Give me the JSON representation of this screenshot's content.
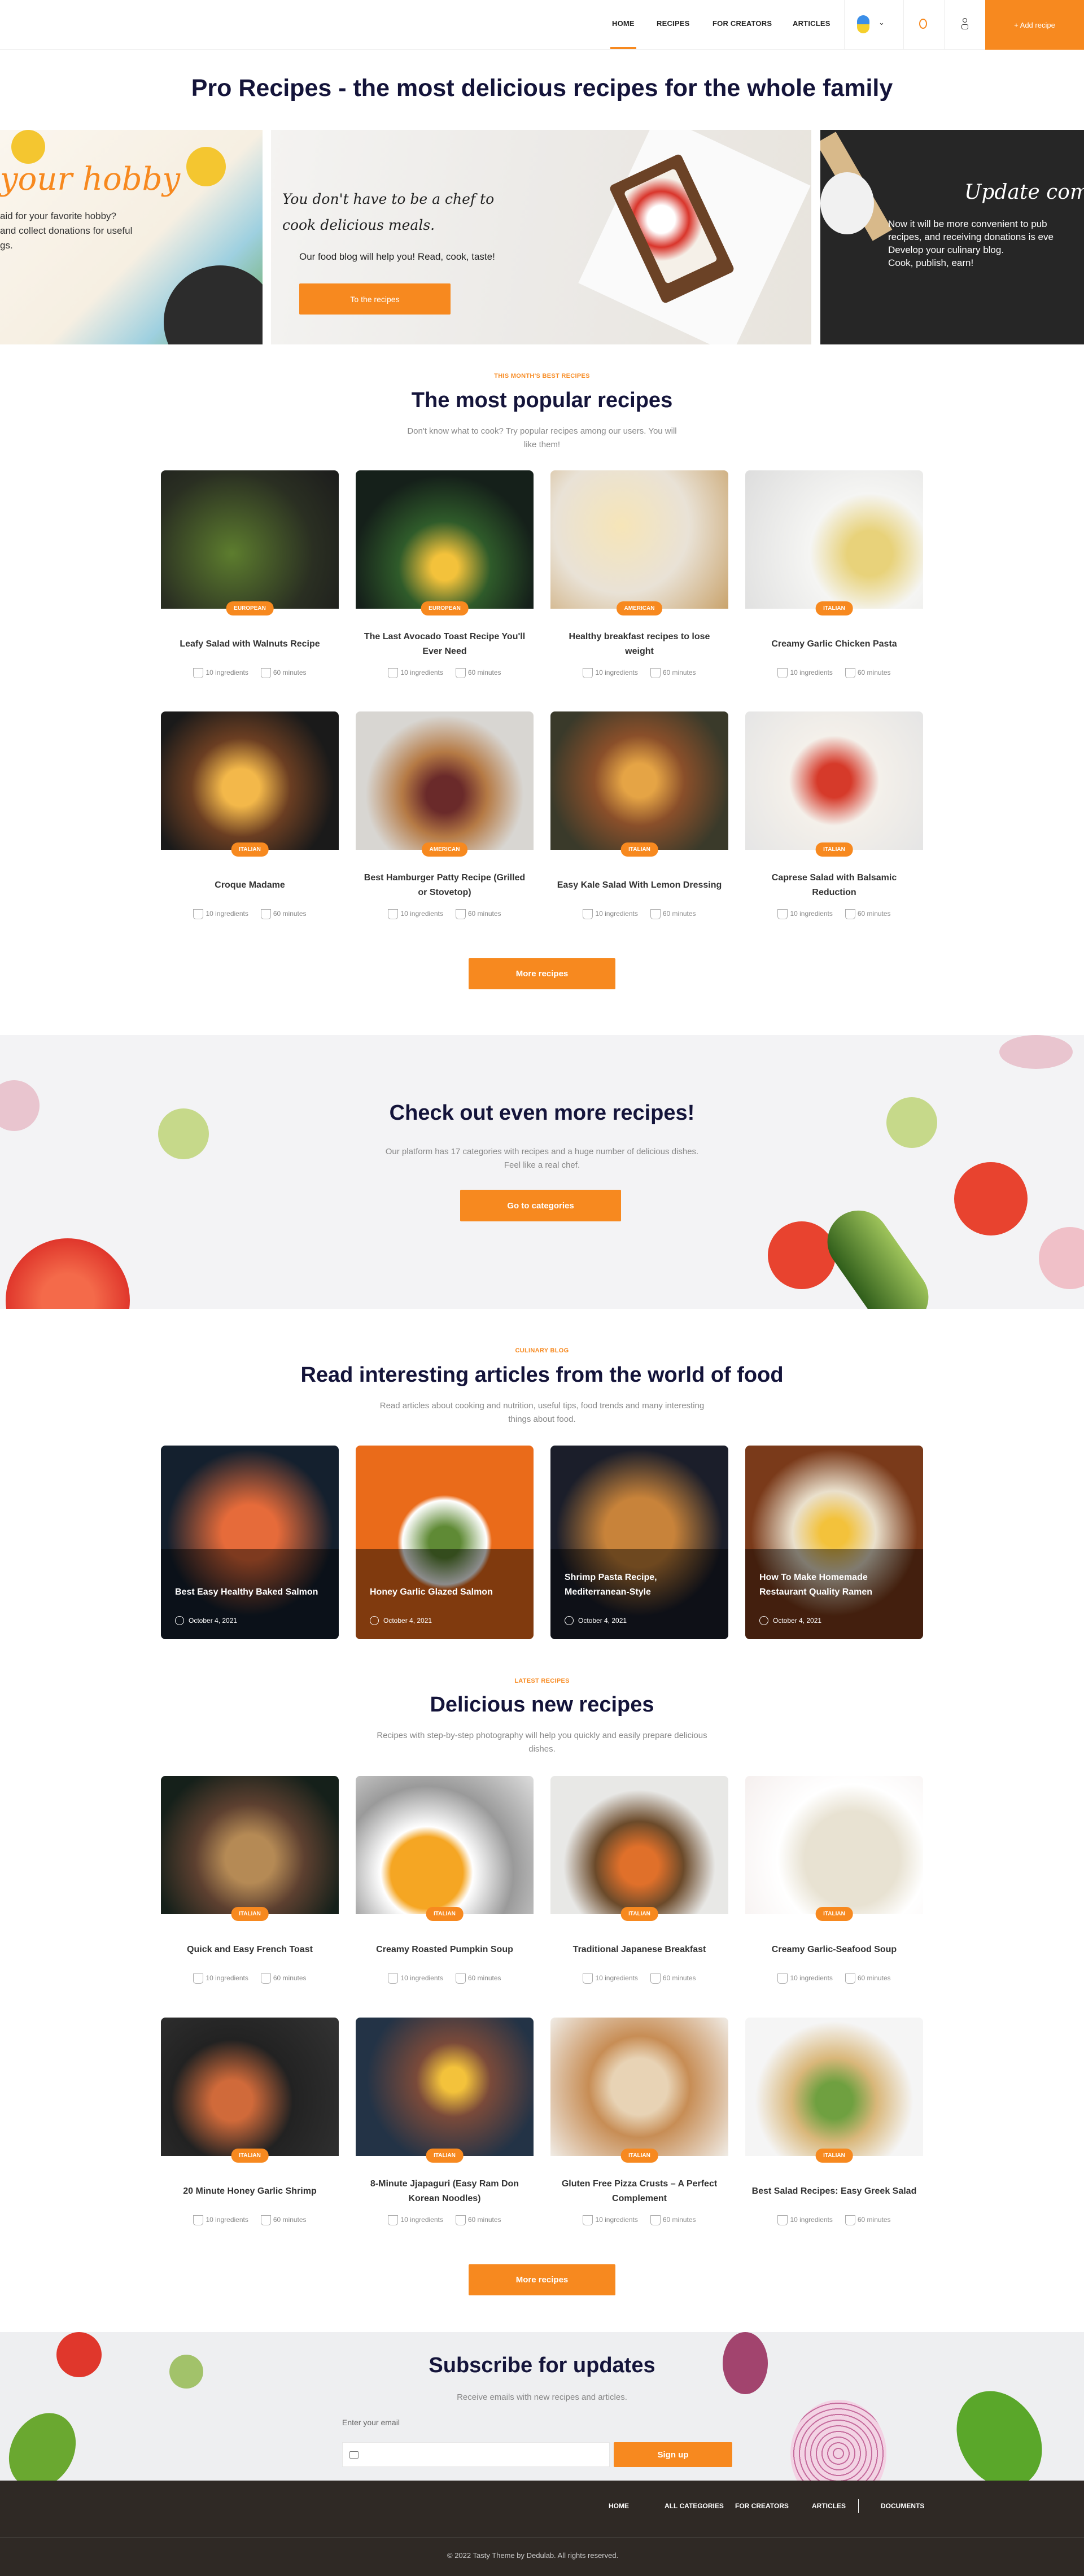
{
  "colors": {
    "accent": "#f7891f",
    "heading": "#14143a",
    "footer_bg": "#2f2925"
  },
  "header": {
    "nav": [
      "HOME",
      "RECIPES",
      "FOR CREATORS",
      "ARTICLES"
    ],
    "active": "HOME",
    "language_icon": "ukraine-flag-icon",
    "add_recipe": "+ Add recipe"
  },
  "page_title": "Pro Recipes - the most delicious recipes for the whole family",
  "hero": {
    "left": {
      "title": "your hobby",
      "text": [
        "aid for your favorite hobby?",
        "and collect donations for useful",
        "gs."
      ]
    },
    "center": {
      "title": "You don't have to be a chef to cook delicious meals.",
      "text": "Our food blog will help you! Read, cook, taste!",
      "button": "To the recipes"
    },
    "right": {
      "title": "Update coming",
      "text": [
        "Now it will be more convenient to pub",
        "recipes, and receiving donations is eve",
        "Develop your culinary blog.",
        "Cook, publish, earn!"
      ]
    }
  },
  "popular": {
    "tag": "THIS MONTH'S BEST RECIPES",
    "title": "The most popular recipes",
    "desc": "Don't know what to cook? Try popular recipes among our users. You will like them!",
    "cards": [
      {
        "badge": "EUROPEAN",
        "title": "Leafy Salad with Walnuts Recipe",
        "ingredients": "10 ingredients",
        "time": "60 minutes"
      },
      {
        "badge": "EUROPEAN",
        "title": "The Last Avocado Toast Recipe You'll Ever Need",
        "ingredients": "10 ingredients",
        "time": "60 minutes"
      },
      {
        "badge": "AMERICAN",
        "title": "Healthy breakfast recipes to lose weight",
        "ingredients": "10 ingredients",
        "time": "60 minutes"
      },
      {
        "badge": "ITALIAN",
        "title": "Creamy Garlic Chicken Pasta",
        "ingredients": "10 ingredients",
        "time": "60 minutes"
      },
      {
        "badge": "ITALIAN",
        "title": "Croque Madame",
        "ingredients": "10 ingredients",
        "time": "60 minutes"
      },
      {
        "badge": "AMERICAN",
        "title": "Best Hamburger Patty Recipe (Grilled or Stovetop)",
        "ingredients": "10 ingredients",
        "time": "60 minutes"
      },
      {
        "badge": "ITALIAN",
        "title": "Easy Kale Salad With Lemon Dressing",
        "ingredients": "10 ingredients",
        "time": "60 minutes"
      },
      {
        "badge": "ITALIAN",
        "title": "Caprese Salad with Balsamic Reduction",
        "ingredients": "10 ingredients",
        "time": "60 minutes"
      }
    ],
    "more": "More recipes"
  },
  "banner": {
    "title": "Check out even more recipes!",
    "desc": "Our platform has 17 categories with recipes and a huge number of delicious dishes. Feel like a real chef.",
    "button": "Go to categories"
  },
  "blog": {
    "tag": "CULINARY BLOG",
    "title": "Read interesting articles from the world of food",
    "desc": "Read articles about cooking and nutrition, useful tips, food trends and many interesting things about food.",
    "cards": [
      {
        "title": "Best Easy Healthy Baked Salmon",
        "date": "October 4, 2021"
      },
      {
        "title": "Honey Garlic Glazed Salmon",
        "date": "October 4, 2021"
      },
      {
        "title": "Shrimp Pasta Recipe, Mediterranean-Style",
        "date": "October 4, 2021"
      },
      {
        "title": "How To Make Homemade Restaurant Quality Ramen",
        "date": "October 4, 2021"
      }
    ]
  },
  "latest": {
    "tag": "LATEST RECIPES",
    "title": "Delicious new recipes",
    "desc": "Recipes with step-by-step photography will help you quickly and easily prepare delicious dishes.",
    "cards": [
      {
        "badge": "ITALIAN",
        "title": "Quick and Easy French Toast",
        "ingredients": "10 ingredients",
        "time": "60 minutes"
      },
      {
        "badge": "ITALIAN",
        "title": "Creamy Roasted Pumpkin Soup",
        "ingredients": "10 ingredients",
        "time": "60 minutes"
      },
      {
        "badge": "ITALIAN",
        "title": "Traditional Japanese Breakfast",
        "ingredients": "10 ingredients",
        "time": "60 minutes"
      },
      {
        "badge": "ITALIAN",
        "title": "Creamy Garlic-Seafood Soup",
        "ingredients": "10 ingredients",
        "time": "60 minutes"
      },
      {
        "badge": "ITALIAN",
        "title": "20 Minute Honey Garlic Shrimp",
        "ingredients": "10 ingredients",
        "time": "60 minutes"
      },
      {
        "badge": "ITALIAN",
        "title": "8-Minute Jjapaguri (Easy Ram Don Korean Noodles)",
        "ingredients": "10 ingredients",
        "time": "60 minutes"
      },
      {
        "badge": "ITALIAN",
        "title": "Gluten Free Pizza Crusts – A Perfect Complement",
        "ingredients": "10 ingredients",
        "time": "60 minutes"
      },
      {
        "badge": "ITALIAN",
        "title": "Best Salad Recipes: Easy Greek Salad",
        "ingredients": "10 ingredients",
        "time": "60 minutes"
      }
    ],
    "more": "More recipes"
  },
  "subscribe": {
    "title": "Subscribe for updates",
    "desc": "Receive emails with new recipes and articles.",
    "label": "Enter your email",
    "placeholder": "",
    "button": "Sign up"
  },
  "footer": {
    "nav": [
      "HOME",
      "ALL CATEGORIES",
      "FOR CREATORS",
      "ARTICLES",
      "DOCUMENTS"
    ],
    "copyright": "© 2022 Tasty Theme by Dedulab. All rights reserved."
  }
}
